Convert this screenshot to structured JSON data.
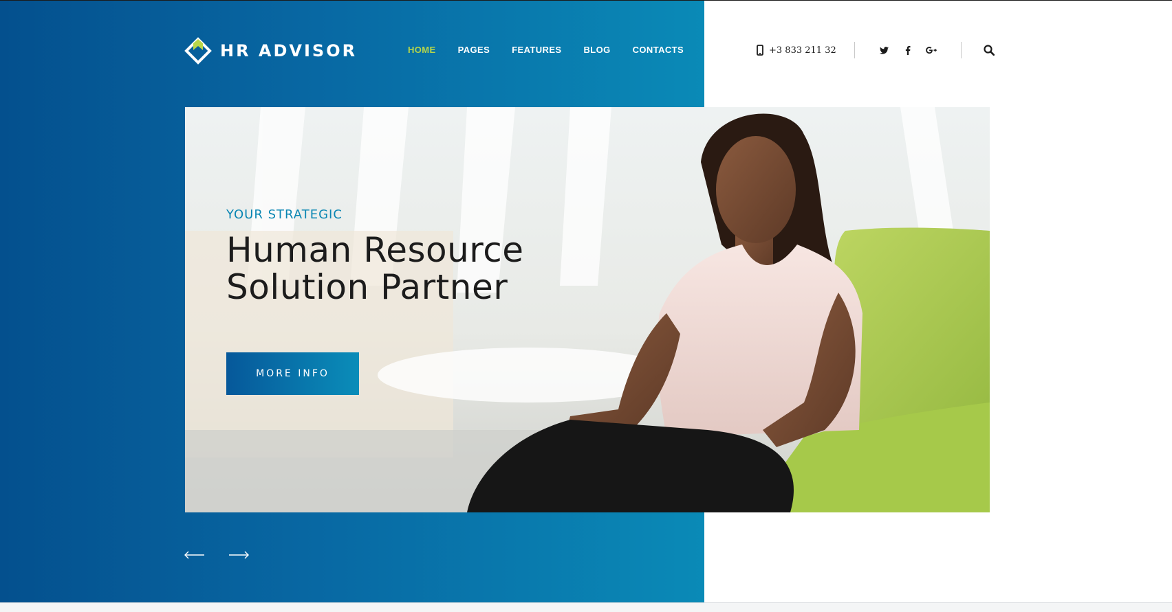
{
  "brand": {
    "name": "HR ADVISOR",
    "logo_icon": "diamond-arrow-logo-icon",
    "accent": "#b7d64a"
  },
  "nav": {
    "items": [
      {
        "label": "HOME",
        "active": true
      },
      {
        "label": "PAGES",
        "active": false
      },
      {
        "label": "FEATURES",
        "active": false
      },
      {
        "label": "BLOG",
        "active": false
      },
      {
        "label": "CONTACTS",
        "active": false
      }
    ]
  },
  "contact": {
    "phone": "+3 833 211 32",
    "phone_icon": "mobile-phone-icon"
  },
  "social": [
    {
      "icon": "twitter-icon"
    },
    {
      "icon": "facebook-icon"
    },
    {
      "icon": "google-plus-icon"
    }
  ],
  "search": {
    "icon": "search-icon"
  },
  "hero": {
    "eyebrow": "YOUR STRATEGIC",
    "headline_line1": "Human Resource",
    "headline_line2": "Solution Partner",
    "button_label": "MORE INFO"
  },
  "slider": {
    "prev_icon": "arrow-left-icon",
    "next_icon": "arrow-right-icon"
  },
  "colors": {
    "blue_dark": "#04508e",
    "blue_light": "#0a8ab7"
  }
}
